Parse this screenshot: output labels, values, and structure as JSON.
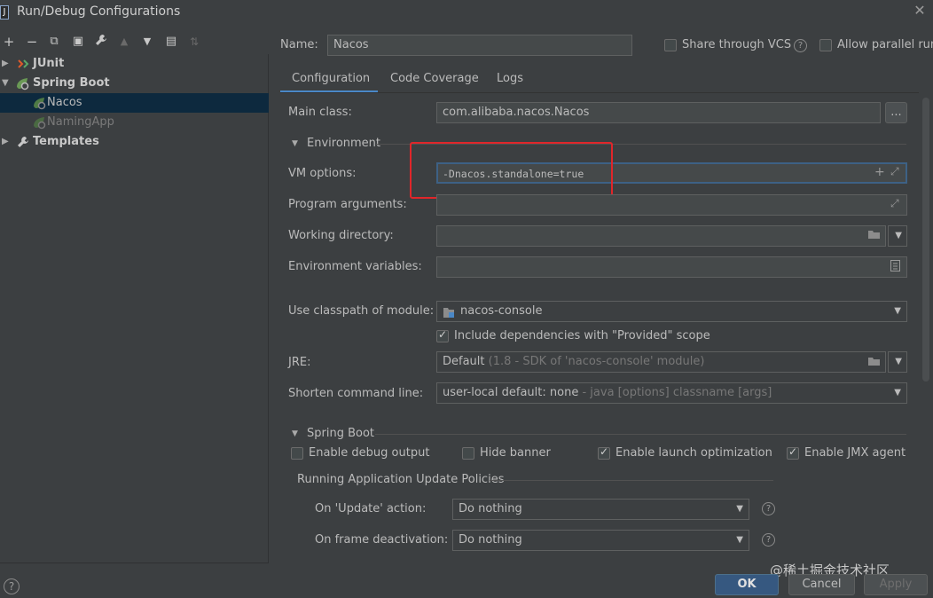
{
  "window": {
    "title": "Run/Debug Configurations",
    "app_icon": "J"
  },
  "toolbar": {
    "icons": [
      "plus-icon",
      "minus-icon",
      "copy-icon",
      "save-icon",
      "wrench-icon",
      "arrow-up-icon",
      "arrow-down-icon",
      "new-folder-icon",
      "sort-icon"
    ],
    "glyphs": {
      "add": "+",
      "remove": "−",
      "copy": "⧉",
      "save": "▣",
      "wrench": "🔧",
      "up": "▲",
      "down": "▼",
      "folder": "▤",
      "sort": "⇅"
    }
  },
  "tree": {
    "items": [
      {
        "label": "JUnit",
        "icon": "junit-icon"
      },
      {
        "label": "Spring Boot",
        "icon": "spring-boot-icon"
      },
      {
        "label": "Nacos",
        "icon": "spring-app-icon"
      },
      {
        "label": "NamingApp",
        "icon": "spring-app-icon"
      },
      {
        "label": "Templates",
        "icon": "wrench-icon"
      }
    ]
  },
  "header": {
    "name_label": "Name:",
    "name_value": "Nacos",
    "share_vcs": "Share through VCS",
    "allow_parallel": "Allow parallel run"
  },
  "tabs": [
    "Configuration",
    "Code Coverage",
    "Logs"
  ],
  "form": {
    "main_class_label": "Main class:",
    "main_class_value": "com.alibaba.nacos.Nacos",
    "browse_label": "...",
    "environment_section": "Environment",
    "vm_options_label": "VM options:",
    "vm_options_value": "-Dnacos.standalone=true",
    "program_args_label": "Program arguments:",
    "working_dir_label": "Working directory:",
    "env_vars_label": "Environment variables:",
    "classpath_label": "Use classpath of module:",
    "classpath_value": "nacos-console",
    "include_deps": "Include dependencies with \"Provided\" scope",
    "jre_label": "JRE:",
    "jre_value": "Default",
    "jre_hint": "(1.8 - SDK of 'nacos-console' module)",
    "shorten_label": "Shorten command line:",
    "shorten_value": "user-local default: none",
    "shorten_hint": "- java [options] classname [args]"
  },
  "spring_boot": {
    "section": "Spring Boot",
    "debug_output": "Enable debug output",
    "hide_banner": "Hide banner",
    "launch_opt": "Enable launch optimization",
    "jmx_agent": "Enable JMX agent",
    "policies_title": "Running Application Update Policies",
    "on_update_label": "On 'Update' action:",
    "on_update_value": "Do nothing",
    "on_frame_label": "On frame deactivation:",
    "on_frame_value": "Do nothing"
  },
  "footer": {
    "help": "?",
    "ok": "OK",
    "cancel": "Cancel",
    "apply": "Apply",
    "watermark": "@稀土掘金技术社区"
  },
  "colors": {
    "highlight_box": "#e0262a",
    "ok_button": "#365880",
    "selection": "#0d293e"
  }
}
